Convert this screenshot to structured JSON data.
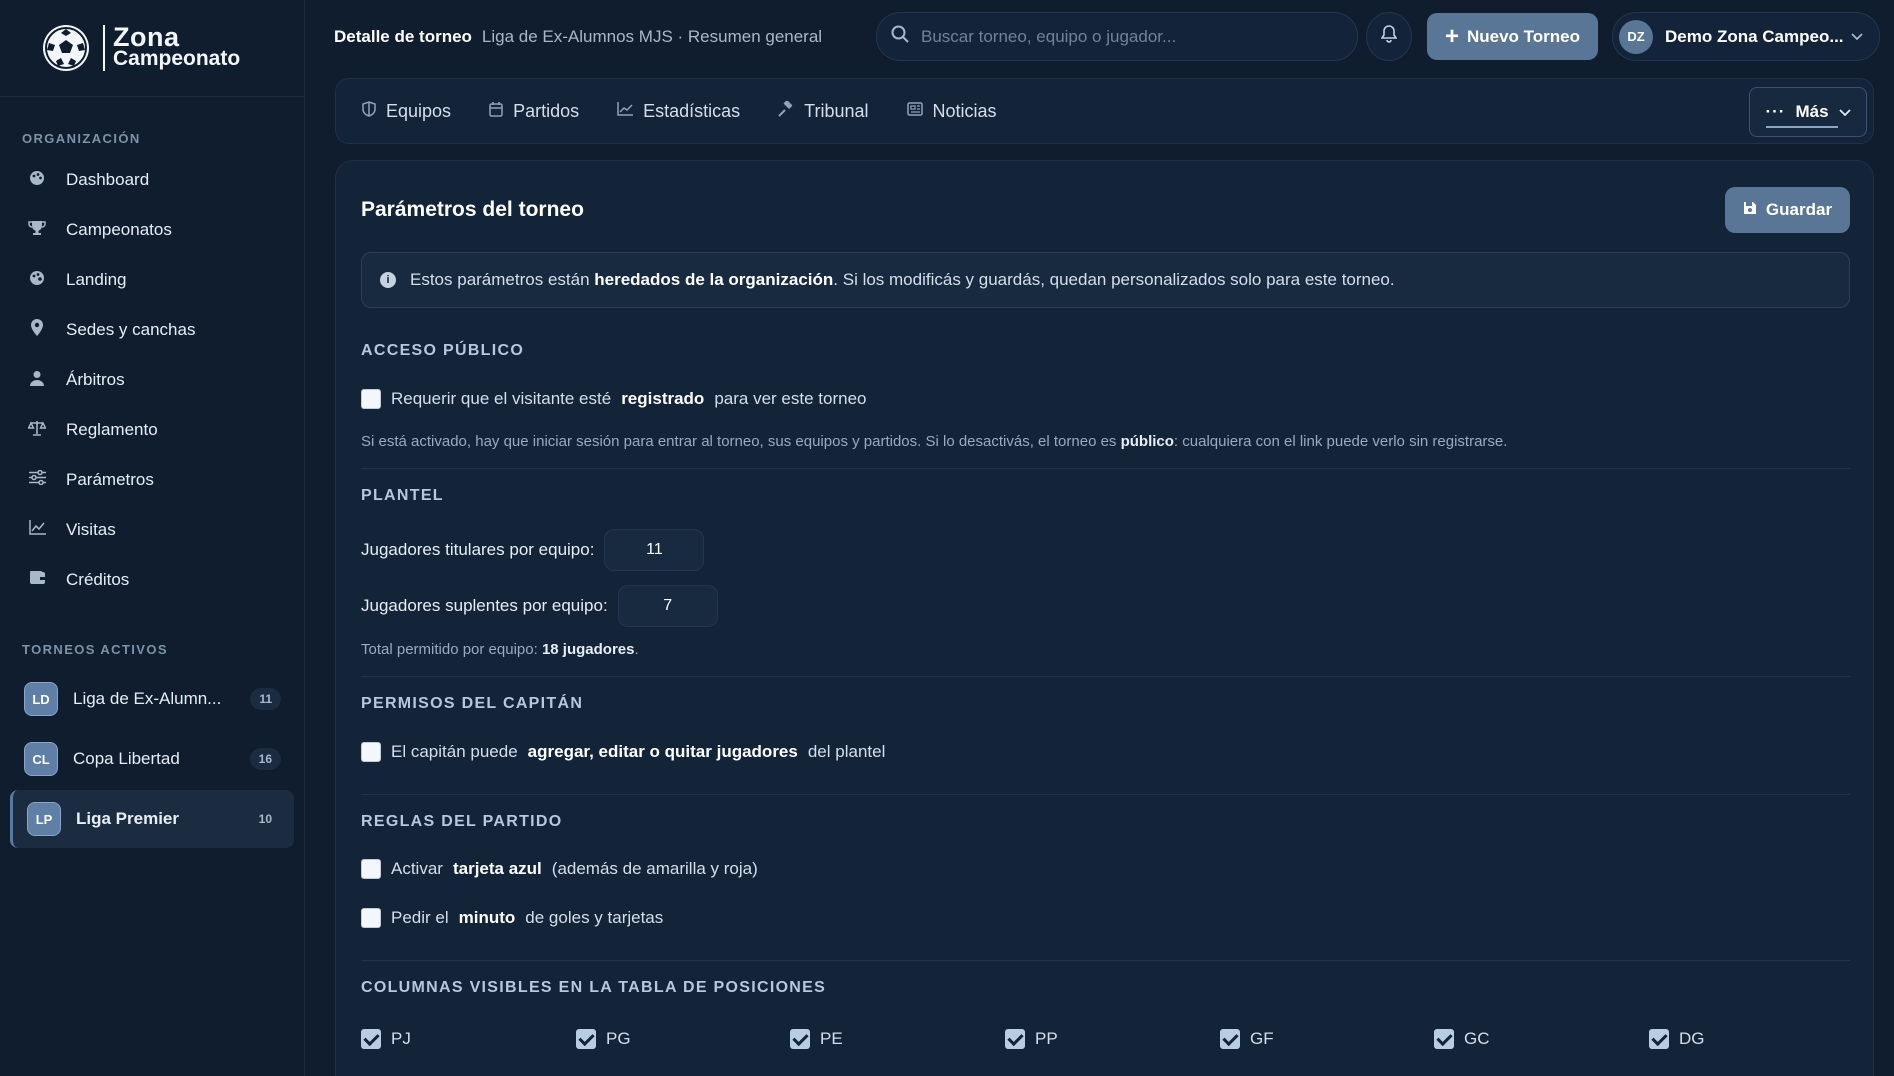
{
  "brand": {
    "line1": "Zona",
    "line2": "Campeonato"
  },
  "sidebar": {
    "org_title": "ORGANIZACIÓN",
    "items": [
      {
        "label": "Dashboard",
        "icon": "palette-icon"
      },
      {
        "label": "Campeonatos",
        "icon": "trophy-icon"
      },
      {
        "label": "Landing",
        "icon": "palette-icon"
      },
      {
        "label": "Sedes y canchas",
        "icon": "location-pin-icon"
      },
      {
        "label": "Árbitros",
        "icon": "user-icon"
      },
      {
        "label": "Reglamento",
        "icon": "scale-icon"
      },
      {
        "label": "Parámetros",
        "icon": "sliders-icon"
      },
      {
        "label": "Visitas",
        "icon": "chart-line-icon"
      },
      {
        "label": "Créditos",
        "icon": "wallet-icon"
      }
    ],
    "active_title": "TORNEOS ACTIVOS",
    "tournaments": [
      {
        "initials": "LD",
        "name": "Liga de Ex-Alumn...",
        "count": "11"
      },
      {
        "initials": "CL",
        "name": "Copa Libertad",
        "count": "16"
      },
      {
        "initials": "LP",
        "name": "Liga Premier",
        "count": "10"
      }
    ]
  },
  "topbar": {
    "crumb_strong": "Detalle de torneo",
    "crumb_rest": "Liga de Ex-Alumnos MJS · Resumen general",
    "search_placeholder": "Buscar torneo, equipo o jugador...",
    "new_button": "Nuevo Torneo",
    "user_initials": "DZ",
    "user_name": "Demo Zona Campeo..."
  },
  "tabs": [
    {
      "label": "Equipos",
      "icon": "shield-icon"
    },
    {
      "label": "Partidos",
      "icon": "calendar-icon"
    },
    {
      "label": "Estadísticas",
      "icon": "chart-line-icon"
    },
    {
      "label": "Tribunal",
      "icon": "gavel-icon"
    },
    {
      "label": "Noticias",
      "icon": "newspaper-icon"
    }
  ],
  "more_label": "Más",
  "panel": {
    "title": "Parámetros del torneo",
    "save_label": "Guardar",
    "info_pre": "Estos parámetros están",
    "info_bold": "heredados de la organización",
    "info_post": ". Si los modificás y guardás, quedan personalizados solo para este torneo.",
    "public": {
      "heading": "ACCESO PÚBLICO",
      "check_pre": "Requerir que el visitante esté",
      "check_bold": "registrado",
      "check_post": "para ver este torneo",
      "checked": false,
      "help_pre": "Si está activado, hay que iniciar sesión para entrar al torneo, sus equipos y partidos. Si lo desactivás, el torneo es",
      "help_bold": "público",
      "help_post": ": cualquiera con el link puede verlo sin registrarse."
    },
    "squad": {
      "heading": "PLANTEL",
      "starters_label": "Jugadores titulares por equipo:",
      "starters_value": "11",
      "subs_label": "Jugadores suplentes por equipo:",
      "subs_value": "7",
      "total_pre": "Total permitido por equipo:",
      "total_bold": "18 jugadores",
      "total_post": "."
    },
    "captain": {
      "heading": "PERMISOS DEL CAPITÁN",
      "check_pre": "El capitán puede",
      "check_bold": "agregar, editar o quitar jugadores",
      "check_post": "del plantel",
      "checked": false
    },
    "rules": {
      "heading": "REGLAS DEL PARTIDO",
      "blue_pre": "Activar",
      "blue_bold": "tarjeta azul",
      "blue_post": "(además de amarilla y roja)",
      "blue_checked": false,
      "minute_pre": "Pedir el",
      "minute_bold": "minuto",
      "minute_post": "de goles y tarjetas",
      "minute_checked": false
    },
    "columns": {
      "heading": "COLUMNAS VISIBLES EN LA TABLA DE POSICIONES",
      "items": [
        {
          "label": "PJ",
          "checked": true
        },
        {
          "label": "PG",
          "checked": true
        },
        {
          "label": "PE",
          "checked": true
        },
        {
          "label": "PP",
          "checked": true
        },
        {
          "label": "GF",
          "checked": true
        },
        {
          "label": "GC",
          "checked": true
        },
        {
          "label": "DG",
          "checked": true
        }
      ]
    }
  }
}
